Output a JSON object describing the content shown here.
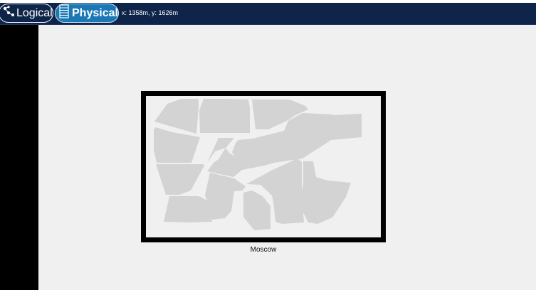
{
  "toolbar": {
    "logical_label": "Logical",
    "physical_label": "Physical",
    "coordinates": "x: 1358m, y: 1626m"
  },
  "map": {
    "caption": "Moscow",
    "district_color": "#d3d3d3",
    "background_color": "#f0f0f0",
    "frame_color": "#000000"
  },
  "colors": {
    "topbar": "#0e2549",
    "active_tab": "#1a78b6"
  },
  "icons": {
    "logical": "graph-nodes-icon",
    "physical": "server-rack-icon"
  }
}
